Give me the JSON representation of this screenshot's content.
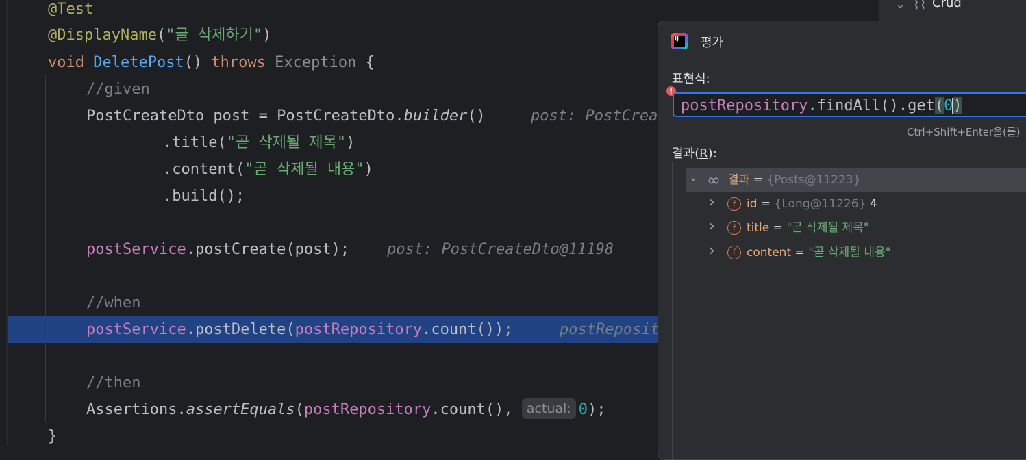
{
  "editor": {
    "lines": [
      {
        "id": "l1",
        "segments": [
          [
            "ann",
            "@Test"
          ]
        ]
      },
      {
        "id": "l2",
        "segments": [
          [
            "ann",
            "@DisplayName"
          ],
          [
            "plain",
            "("
          ],
          [
            "str",
            "\"글 삭제하기\""
          ],
          [
            "plain",
            ")"
          ]
        ]
      },
      {
        "id": "l3",
        "segments": [
          [
            "kw",
            "void "
          ],
          [
            "fn",
            "DeletePost"
          ],
          [
            "plain",
            "() "
          ],
          [
            "kw",
            "throws "
          ],
          [
            "cls-dim",
            "Exception"
          ],
          [
            "plain",
            " {"
          ]
        ]
      },
      {
        "id": "l4",
        "segments": [
          [
            "cmt",
            "//given"
          ]
        ]
      },
      {
        "id": "l5",
        "segments": [
          [
            "plain",
            "PostCreateDto post = PostCreateDto."
          ],
          [
            "it",
            "builder"
          ],
          [
            "plain",
            "()"
          ]
        ],
        "hint": "post: PostCrea"
      },
      {
        "id": "l6",
        "segments": [
          [
            "plain",
            ".title("
          ],
          [
            "str",
            "\"곧 삭제될 제목\""
          ],
          [
            "plain",
            ")"
          ]
        ]
      },
      {
        "id": "l7",
        "segments": [
          [
            "plain",
            ".content("
          ],
          [
            "str",
            "\"곧 삭제될 내용\""
          ],
          [
            "plain",
            ")"
          ]
        ]
      },
      {
        "id": "l8",
        "segments": [
          [
            "plain",
            ".build();"
          ]
        ]
      },
      {
        "id": "l9",
        "segments": []
      },
      {
        "id": "l10",
        "segments": [
          [
            "fld",
            "postService"
          ],
          [
            "plain",
            ".postCreate(post);"
          ]
        ],
        "hint": "post: PostCreateDto@11198"
      },
      {
        "id": "l11",
        "segments": []
      },
      {
        "id": "l12",
        "segments": [
          [
            "cmt",
            "//when"
          ]
        ]
      },
      {
        "id": "l13",
        "segments": [
          [
            "fld",
            "postService"
          ],
          [
            "plain",
            ".postDelete("
          ],
          [
            "fld",
            "postRepository"
          ],
          [
            "plain",
            ".count());"
          ]
        ],
        "hint": "postReposit"
      },
      {
        "id": "l14",
        "segments": []
      },
      {
        "id": "l15",
        "segments": [
          [
            "cmt",
            "//then"
          ]
        ]
      },
      {
        "id": "l16",
        "segments": [
          [
            "plain",
            "Assertions."
          ],
          [
            "it",
            "assertEquals"
          ],
          [
            "plain",
            "("
          ],
          [
            "fld",
            "postRepository"
          ],
          [
            "plain",
            ".count(), "
          ]
        ],
        "param": "actual:",
        "after": [
          [
            "num",
            "0"
          ],
          [
            "plain",
            ");"
          ]
        ]
      },
      {
        "id": "l17",
        "segments": [
          [
            "plain",
            "}"
          ]
        ]
      }
    ]
  },
  "structure_panel": {
    "node_label": "Crud"
  },
  "evaluate_dialog": {
    "title": "평가",
    "expression_label": "표현식:",
    "expression": {
      "field": "postRepository",
      "rest": ".findAll().get",
      "open": "(",
      "arg": "0",
      "close": ")"
    },
    "shortcut_hint": "Ctrl+Shift+Enter을(를)",
    "result_label_prefix": "결과(",
    "result_label_mnemonic": "R",
    "result_label_suffix": "):",
    "tree": [
      {
        "name": "결과",
        "eq": " = ",
        "ref": "{Posts@11223}",
        "value": "",
        "kind": "root"
      },
      {
        "name": "id",
        "eq": " = ",
        "ref": "{Long@11226}",
        "value": " 4",
        "kind": "field"
      },
      {
        "name": "title",
        "eq": " = ",
        "ref": "",
        "value": "\"곧 삭제될 제목\"",
        "kind": "field-str"
      },
      {
        "name": "content",
        "eq": " = ",
        "ref": "",
        "value": "\"곧 삭제될 내용\"",
        "kind": "field-str"
      }
    ]
  }
}
